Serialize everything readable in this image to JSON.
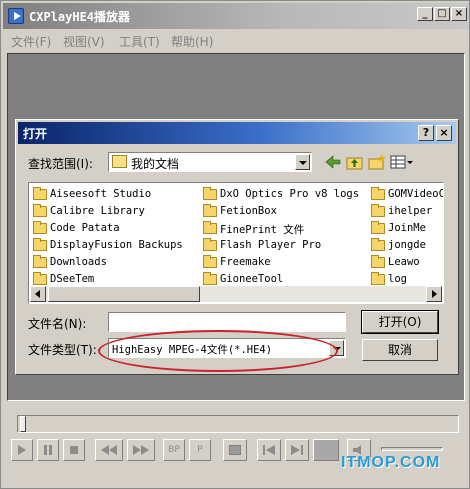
{
  "app": {
    "title": "CXPlayHE4播放器",
    "menu": [
      "文件(F)",
      "视图(V)",
      "工具(T)",
      "帮助(H)"
    ],
    "window_buttons": [
      "_",
      "□",
      "×"
    ],
    "controls": [
      "BP",
      "P"
    ],
    "watermark": "ITMOP.COM"
  },
  "dialog": {
    "title": "打开",
    "help_button": "?",
    "close_button": "×",
    "look_in_label": "查找范围(I):",
    "look_in_value": "我的文档",
    "files": [
      "Aiseesoft Studio",
      "Calibre Library",
      "Code Patata",
      "DisplayFusion Backups",
      "Downloads",
      "DSeeTem",
      "DxO Optics Pro v8 logs",
      "FetionBox",
      "FinePrint 文件",
      "Flash Player Pro",
      "Freemake",
      "GioneeTool",
      "GOMVideoC",
      "ihelper",
      "JoinMe",
      "jongde",
      "Leawo",
      "log"
    ],
    "file_name_label": "文件名(N):",
    "file_name_value": "",
    "file_type_label": "文件类型(T):",
    "file_type_value": "HighEasy MPEG-4文件(*.HE4)",
    "open_button": "打开(O)",
    "cancel_button": "取消"
  },
  "colors": {
    "dialog_titlebar": "#0a246a",
    "highlight_ellipse": "#c8242a",
    "watermark": "#2a9bd6"
  }
}
